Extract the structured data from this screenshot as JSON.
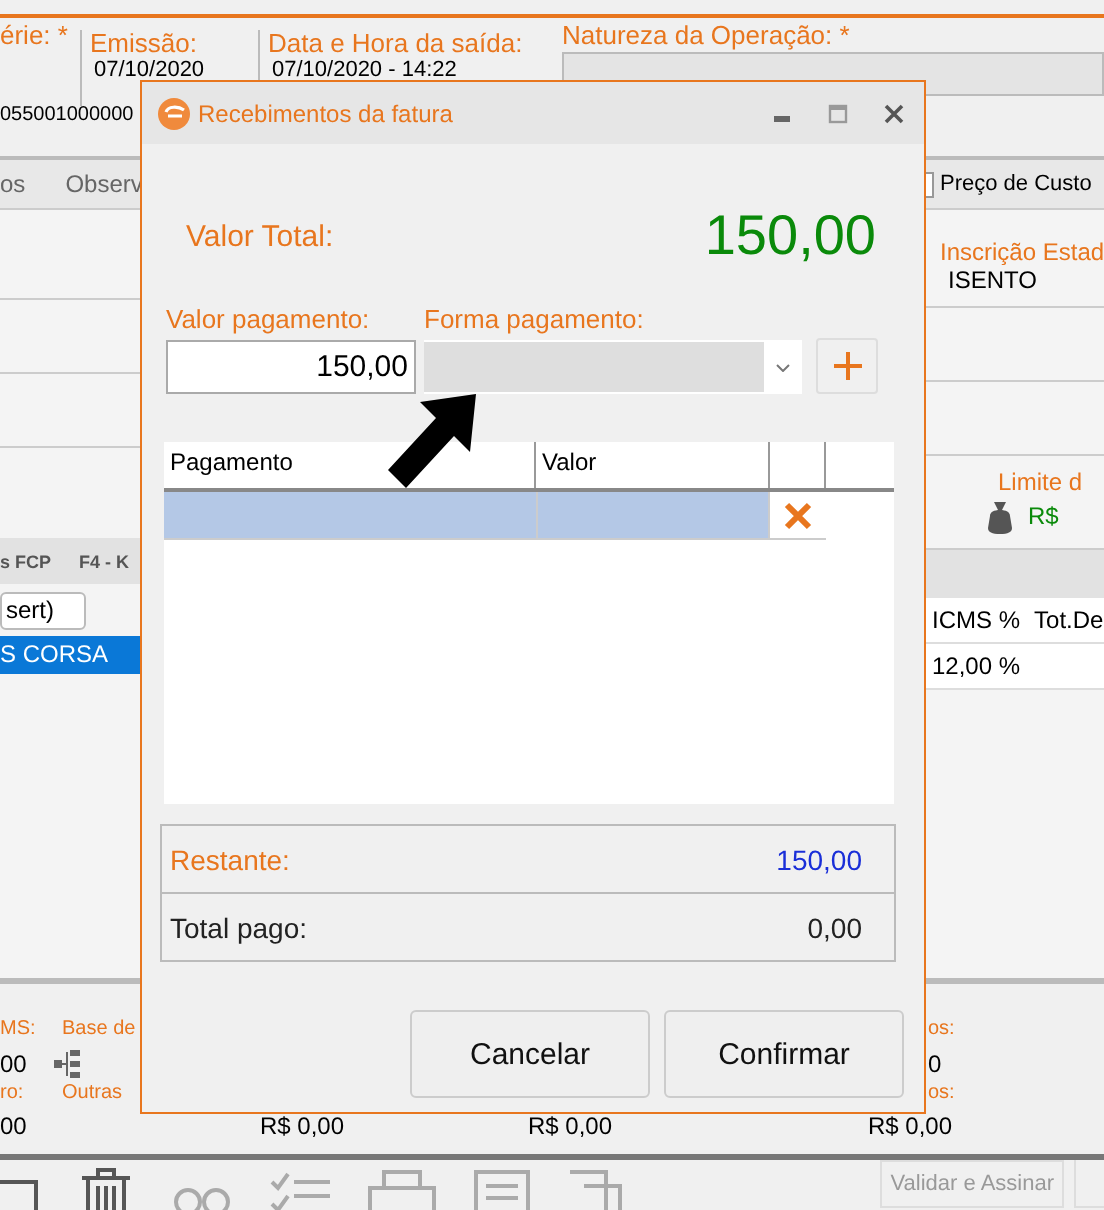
{
  "header": {
    "fields": [
      {
        "label": "érie: *"
      },
      {
        "label": "Emissão:",
        "value": "07/10/2020"
      },
      {
        "label": "Data e Hora da saída:",
        "value": "07/10/2020 - 14:22"
      },
      {
        "label": "Natureza da Operação: *"
      }
    ],
    "access_key": "055001000000"
  },
  "tabs": [
    {
      "label": "os",
      "selected": false
    },
    {
      "label": "Observ",
      "selected": false
    }
  ],
  "cost_price": {
    "label": "Preço de Custo",
    "checked": false
  },
  "right_panel": {
    "state_registration_label": "Inscrição Estad",
    "state_registration": "ISENTO",
    "limit_label": "Limite d",
    "limit_value": "R$"
  },
  "items_grid": {
    "tabs": [
      "s FCP",
      "F4 - K"
    ],
    "insert_button": "sert)",
    "columns": [
      "ICMS %",
      "Tot.De"
    ],
    "rows": [
      {
        "description": "S CORSA",
        "icms": "12,00 %",
        "selected": true
      }
    ]
  },
  "totals": {
    "left": [
      {
        "label": "MS:",
        "value": "00"
      },
      {
        "label": "ro:",
        "value": "00"
      }
    ],
    "middle_labels": [
      "Base de",
      "Outras"
    ],
    "amounts": [
      "R$ 0,00",
      "R$ 0,00"
    ],
    "right": [
      {
        "label": "os:",
        "value": "0"
      },
      {
        "label": "os:",
        "value": "R$ 0,00"
      }
    ]
  },
  "toolbar": {
    "validate_button": {
      "label": "Validar e Assinar",
      "disabled": true
    }
  },
  "dialog": {
    "title": "Recebimentos da fatura",
    "total_label": "Valor Total:",
    "total_value": "150,00",
    "amount_label": "Valor pagamento:",
    "amount_value": "150,00",
    "method_label": "Forma pagamento:",
    "method_disabled": true,
    "table": {
      "columns": [
        "Pagamento",
        "Valor"
      ],
      "rows": [
        {
          "selected": true
        }
      ]
    },
    "summary": [
      {
        "label": "Restante:",
        "value": "150,00",
        "kind": "remaining"
      },
      {
        "label": "Total pago:",
        "value": "0,00",
        "kind": "paid"
      }
    ],
    "buttons": [
      "Cancelar",
      "Confirmar"
    ]
  }
}
